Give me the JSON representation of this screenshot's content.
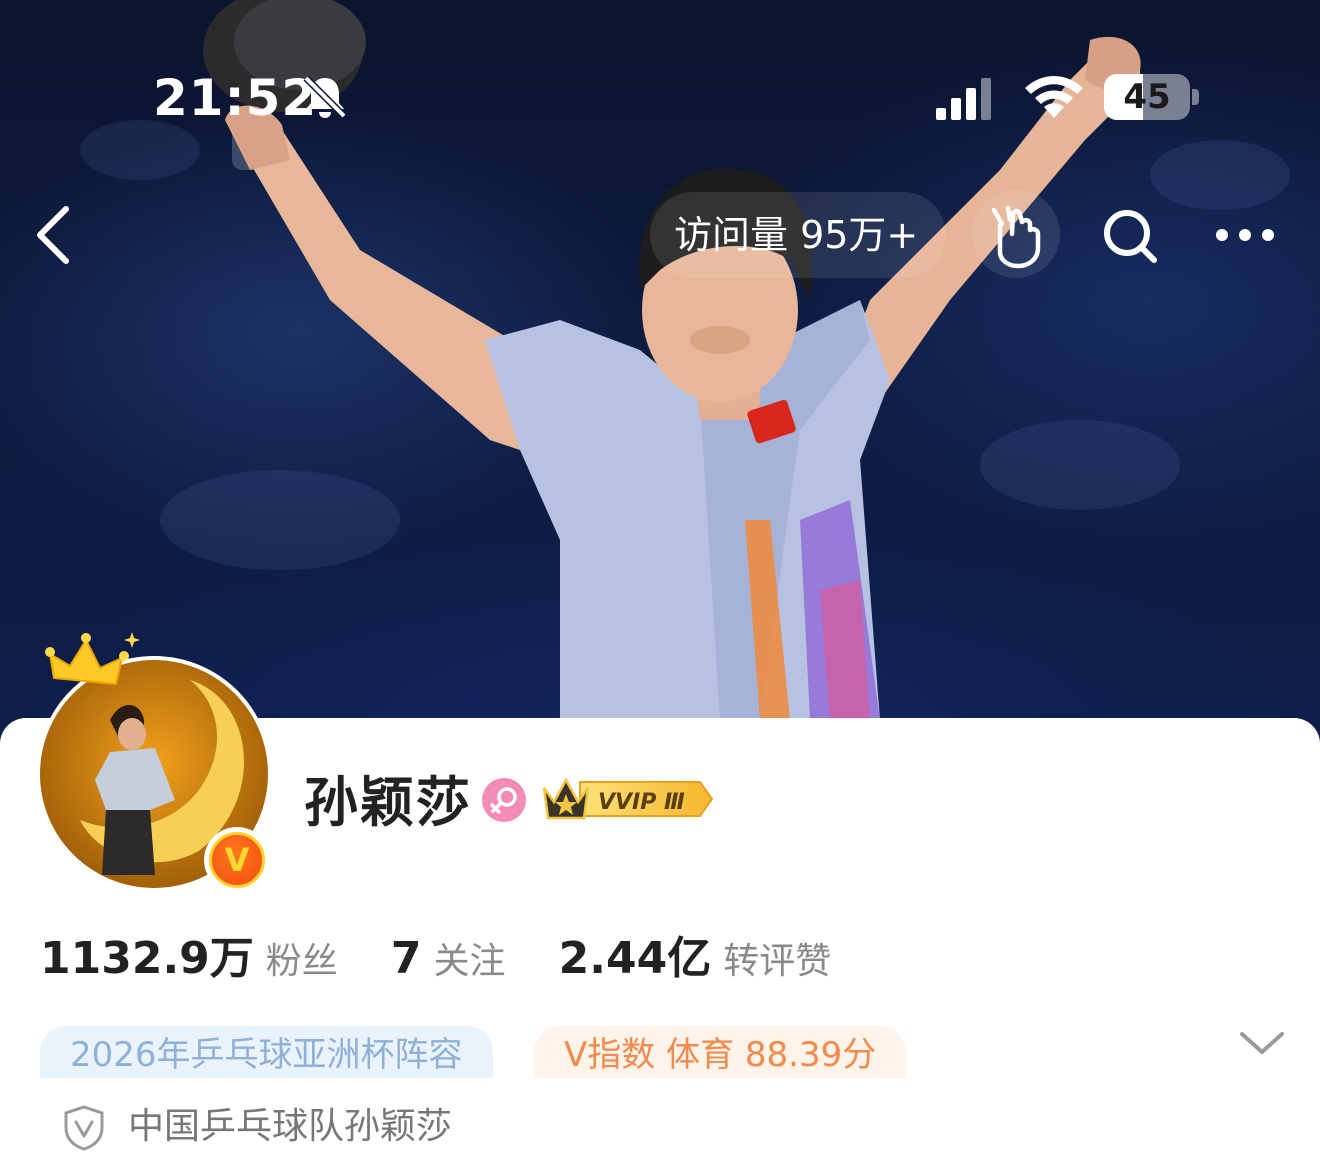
{
  "status_bar": {
    "time": "21:52",
    "battery_level": "45",
    "battery_fraction": 0.45,
    "icons": [
      "bell-muted-icon",
      "signal-icon",
      "wifi-icon",
      "battery-icon"
    ]
  },
  "nav": {
    "visits_label": "访问量 95万+",
    "icons": [
      "back-icon",
      "heart-hands-icon",
      "search-icon",
      "more-icon"
    ]
  },
  "profile": {
    "name": "孙颖莎",
    "gender_icon": "female-icon",
    "vip_label": "VVIP Ⅲ",
    "verified_badge": "V",
    "stats": [
      {
        "value": "1132.9万",
        "label": "粉丝"
      },
      {
        "value": "7",
        "label": "关注"
      },
      {
        "value": "2.44亿",
        "label": "转评赞"
      }
    ],
    "tags": [
      {
        "label": "2026年乒乓球亚洲杯阵容"
      },
      {
        "label": "V指数 体育 88.39分"
      }
    ],
    "verification": "中国乒乓球队孙颖莎"
  },
  "colors": {
    "cover_dark": "#0d1a3d",
    "gender_pink": "#f38bb7",
    "vip_gold": "#f5c542",
    "tag_blue_bg": "#eaf2fb",
    "tag_blue_text": "#8fb1d8",
    "tag_orange_bg": "#fff3ea",
    "tag_orange_text": "#f18a4a"
  }
}
